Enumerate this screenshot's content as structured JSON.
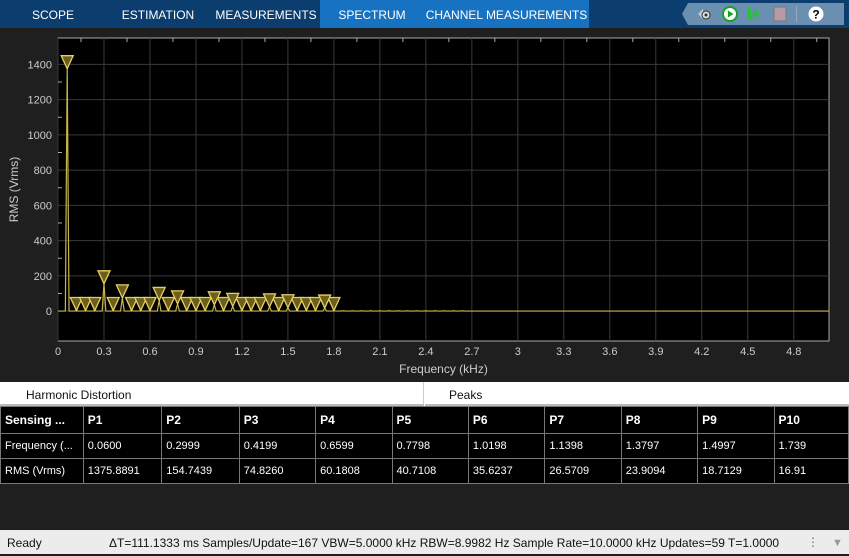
{
  "tabs": [
    {
      "label": "SCOPE",
      "active": false
    },
    {
      "label": "ESTIMATION",
      "active": false
    },
    {
      "label": "MEASUREMENTS",
      "active": false
    },
    {
      "label": "SPECTRUM",
      "active": true
    },
    {
      "label": "CHANNEL MEASUREMENTS",
      "active": false
    }
  ],
  "toolbar": {
    "icons": [
      "settings-icon",
      "run-icon",
      "step-forward-icon",
      "stop-icon",
      "help-icon"
    ],
    "help": "?"
  },
  "colors": {
    "trace": "#c8b44a",
    "marker": "#e8d060",
    "tab_active": "#1773c2",
    "tab_bar": "#0b3d6e"
  },
  "chart_data": {
    "type": "line",
    "xlabel": "Frequency (kHz)",
    "ylabel": "RMS (Vrms)",
    "xlim": [
      0,
      5.03
    ],
    "ylim": [
      -170,
      1550
    ],
    "grid": true,
    "xticks": [
      "0",
      "0.3",
      "0.6",
      "0.9",
      "1.2",
      "1.5",
      "1.8",
      "2.1",
      "2.4",
      "2.7",
      "3",
      "3.3",
      "3.6",
      "3.9",
      "4.2",
      "4.5",
      "4.8"
    ],
    "yticks": [
      "0",
      "200",
      "400",
      "600",
      "800",
      "1000",
      "1200",
      "1400"
    ],
    "peaks": [
      [
        0.06,
        1375.9
      ],
      [
        0.3,
        154.7
      ],
      [
        0.42,
        74.8
      ],
      [
        0.66,
        60.2
      ],
      [
        0.78,
        40.7
      ],
      [
        1.02,
        35.6
      ],
      [
        1.14,
        26.6
      ],
      [
        1.38,
        23.9
      ],
      [
        1.5,
        18.7
      ],
      [
        1.74,
        16.9
      ]
    ],
    "minor_markers": [
      0.12,
      0.18,
      0.24,
      0.36,
      0.48,
      0.54,
      0.6,
      0.72,
      0.84,
      0.9,
      0.96,
      1.08,
      1.2,
      1.26,
      1.32,
      1.44,
      1.56,
      1.62,
      1.68,
      1.8
    ]
  },
  "panel_tabs": [
    "Harmonic Distortion",
    "Peaks"
  ],
  "table": {
    "headers": [
      "Sensing ...",
      "P1",
      "P2",
      "P3",
      "P4",
      "P5",
      "P6",
      "P7",
      "P8",
      "P9",
      "P10"
    ],
    "rows": [
      [
        "Frequency (...",
        "0.0600",
        "0.2999",
        "0.4199",
        "0.6599",
        "0.7798",
        "1.0198",
        "1.1398",
        "1.3797",
        "1.4997",
        "1.739"
      ],
      [
        "RMS (Vrms)",
        "1375.8891",
        "154.7439",
        "74.8260",
        "60.1808",
        "40.7108",
        "35.6237",
        "26.5709",
        "23.9094",
        "18.7129",
        "16.91"
      ]
    ]
  },
  "status": {
    "state": "Ready",
    "info": "ΔT=111.1333 ms  Samples/Update=167  VBW=5.0000 kHz  RBW=8.9982 Hz  Sample Rate=10.0000 kHz  Updates=59  T=1.0000"
  }
}
